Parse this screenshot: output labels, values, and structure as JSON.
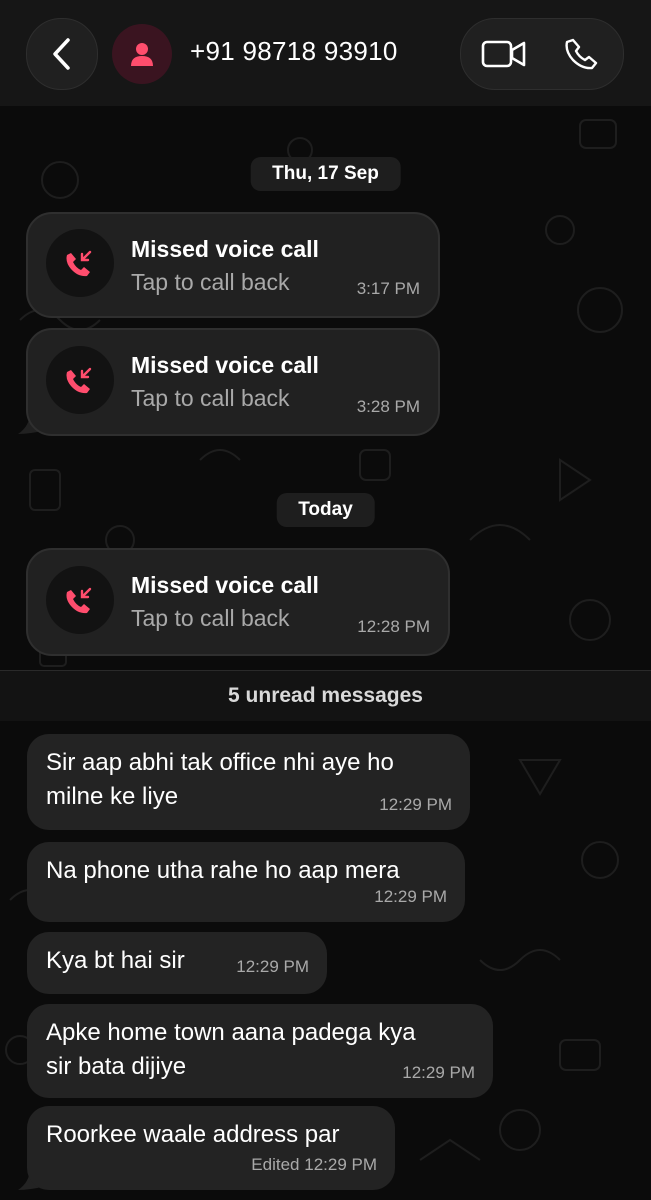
{
  "header": {
    "contact": "+91 98718 93910",
    "icons": {
      "back": "chevron-left-icon",
      "avatar": "person-icon",
      "video": "video-camera-icon",
      "call": "phone-icon"
    },
    "colors": {
      "avatar_bg": "#3a1420",
      "avatar_fg": "#ff4d6d"
    }
  },
  "dates": {
    "first": "Thu, 17 Sep",
    "second": "Today"
  },
  "calls": [
    {
      "title": "Missed voice call",
      "subtitle": "Tap to call back",
      "time": "3:17 PM",
      "icon": "missed-call-icon"
    },
    {
      "title": "Missed voice call",
      "subtitle": "Tap to call back",
      "time": "3:28 PM",
      "icon": "missed-call-icon"
    },
    {
      "title": "Missed voice call",
      "subtitle": "Tap to call back",
      "time": "12:28 PM",
      "icon": "missed-call-icon"
    }
  ],
  "unread_label": "5 unread messages",
  "messages": [
    {
      "line1": "Sir aap abhi tak office nhi aye ho",
      "line2": "milne ke liye",
      "time": "12:29 PM"
    },
    {
      "line1": "Na phone utha rahe ho aap mera",
      "time": "12:29 PM"
    },
    {
      "line1": "Kya bt hai sir",
      "time": "12:29 PM"
    },
    {
      "line1": "Apke home town aana padega kya",
      "line2": "sir bata dijiye",
      "time": "12:29 PM"
    },
    {
      "line1": "Roorkee waale address par",
      "edited": "Edited",
      "time": "12:29 PM"
    }
  ],
  "theme": {
    "missed_call_red": "#ff4d6d",
    "bubble": "#232323",
    "background": "#0b0b0b"
  }
}
